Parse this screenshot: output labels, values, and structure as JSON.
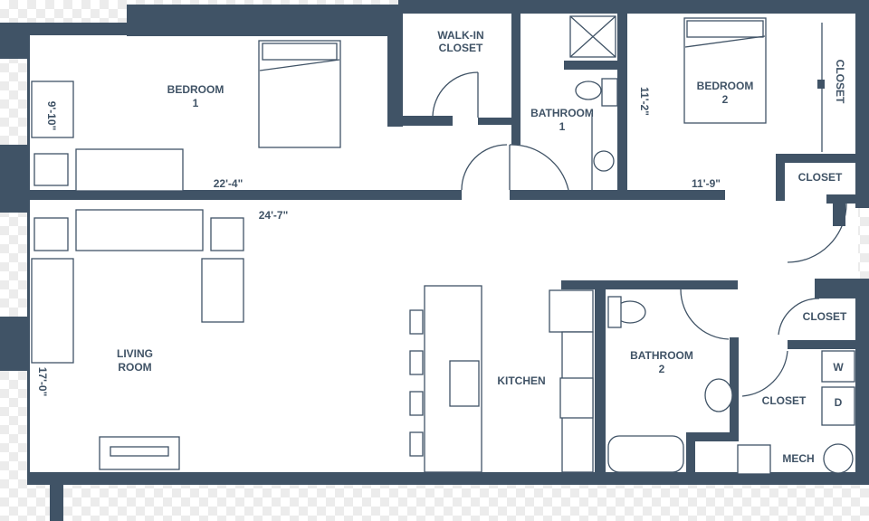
{
  "rooms": {
    "bedroom1": {
      "name": "BEDROOM",
      "number": "1"
    },
    "walk_in_closet": {
      "line1": "WALK-IN",
      "line2": "CLOSET"
    },
    "bathroom1": {
      "name": "BATHROOM",
      "number": "1"
    },
    "bedroom2": {
      "name": "BEDROOM",
      "number": "2"
    },
    "bedroom2_closet": "CLOSET",
    "hall_closet": "CLOSET",
    "closet_upper_right": "CLOSET",
    "closet_laundry": "CLOSET",
    "living_room": {
      "line1": "LIVING",
      "line2": "ROOM"
    },
    "kitchen": "KITCHEN",
    "bathroom2": {
      "name": "BATHROOM",
      "number": "2"
    },
    "mech": "MECH"
  },
  "dimensions": {
    "bedroom1_depth": "9'-10\"",
    "bedroom1_width": "22'-4\"",
    "living_width": "24'-7\"",
    "living_depth": "17'-0\"",
    "bedroom2_depth": "11'-2\"",
    "bedroom2_width": "11'-9\""
  },
  "appliances": {
    "washer": "W",
    "dryer": "D"
  },
  "colors": {
    "wall": "#405366",
    "floor": "#ffffff"
  }
}
